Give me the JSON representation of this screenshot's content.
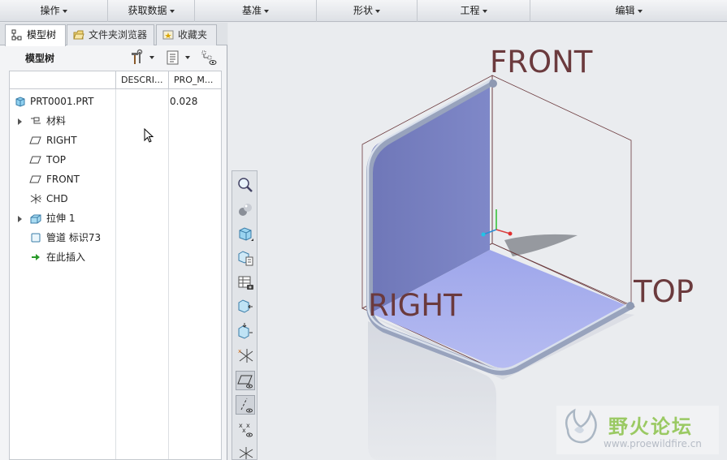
{
  "ribbon": {
    "groups": [
      {
        "label": "操作"
      },
      {
        "label": "获取数据"
      },
      {
        "label": "基准"
      },
      {
        "label": "形状"
      },
      {
        "label": "工程"
      },
      {
        "label": "编辑"
      }
    ]
  },
  "tabs": [
    {
      "label": "模型树"
    },
    {
      "label": "文件夹浏览器"
    },
    {
      "label": "收藏夹"
    }
  ],
  "panel": {
    "title": "模型树"
  },
  "tree": {
    "columns": [
      "DESCRI...",
      "PRO_M..."
    ],
    "rows": [
      {
        "label": "PRT0001.PRT",
        "value": "0.028",
        "icon": "part-icon"
      },
      {
        "label": "材料",
        "icon": "material-icon",
        "expandable": true
      },
      {
        "label": "RIGHT",
        "icon": "datum-plane-icon"
      },
      {
        "label": "TOP",
        "icon": "datum-plane-icon"
      },
      {
        "label": "FRONT",
        "icon": "datum-plane-icon"
      },
      {
        "label": "CHD",
        "icon": "csys-icon"
      },
      {
        "label": "拉伸 1",
        "icon": "extrude-icon",
        "expandable": true
      },
      {
        "label": "管道 标识73",
        "icon": "pipe-icon"
      },
      {
        "label": "在此插入",
        "icon": "insert-here-icon"
      }
    ]
  },
  "viewport": {
    "plane_labels": {
      "front": "FRONT",
      "right": "RIGHT",
      "top": "TOP"
    }
  },
  "watermark": {
    "title": "野火论坛",
    "url": "www.proewildfire.cn"
  },
  "colors": {
    "plane_label": "#6b3a3d",
    "surface": "#7f86c4",
    "pipe": "#a8b4cc",
    "watermark_green": "#8cc34a"
  }
}
